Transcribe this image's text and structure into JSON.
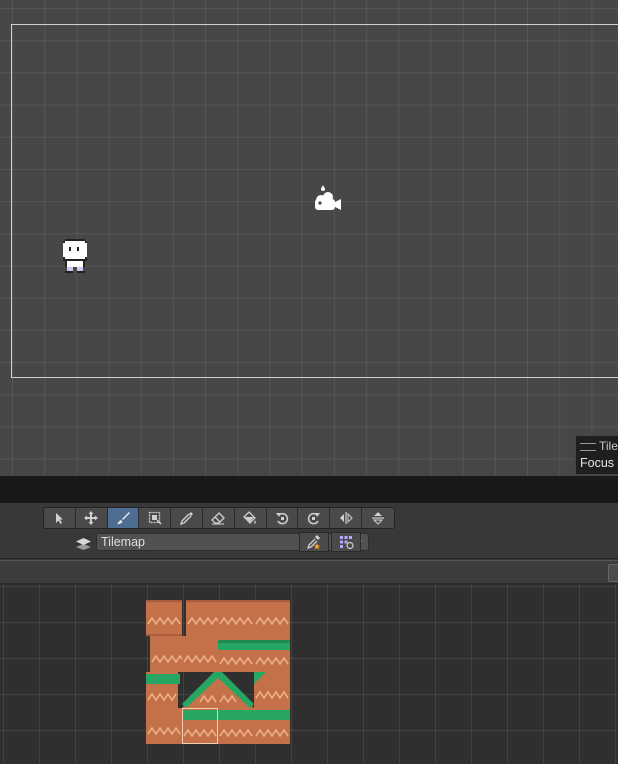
{
  "scene": {
    "overlay": {
      "title": "Tile",
      "focus_label": "Focus"
    }
  },
  "tile_palette": {
    "tools": [
      {
        "name": "select-tool",
        "icon": "arrow-pointer-icon",
        "active": false
      },
      {
        "name": "move-tool",
        "icon": "move-arrows-icon",
        "active": false
      },
      {
        "name": "paint-tool",
        "icon": "paintbrush-icon",
        "active": true
      },
      {
        "name": "box-fill-tool",
        "icon": "box-fill-icon",
        "active": false
      },
      {
        "name": "pick-tool",
        "icon": "eyedropper-icon",
        "active": false
      },
      {
        "name": "erase-tool",
        "icon": "eraser-icon",
        "active": false
      },
      {
        "name": "flood-fill-tool",
        "icon": "paint-bucket-icon",
        "active": false
      },
      {
        "name": "rotate-ccw-tool",
        "icon": "rotate-left-icon",
        "active": false
      },
      {
        "name": "rotate-cw-tool",
        "icon": "rotate-right-icon",
        "active": false
      },
      {
        "name": "flip-x-tool",
        "icon": "flip-horizontal-icon",
        "active": false
      },
      {
        "name": "flip-y-tool",
        "icon": "flip-vertical-icon",
        "active": false
      }
    ],
    "active_tilemap": "Tilemap",
    "colors": {
      "accent": "#4d6d93",
      "dirt": "#c4714a",
      "grass": "#27a563"
    }
  }
}
